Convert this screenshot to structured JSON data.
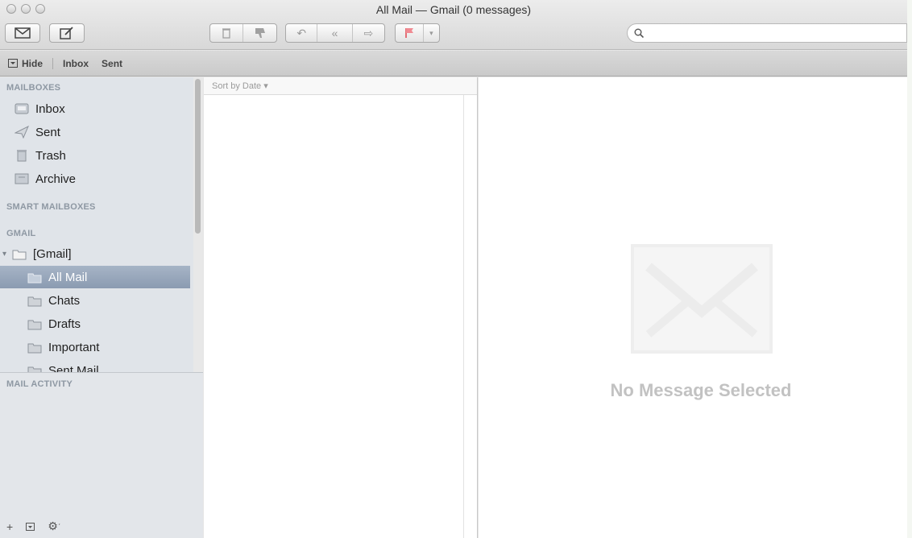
{
  "window": {
    "title": "All Mail — Gmail (0 messages)"
  },
  "toolbar": {
    "search_placeholder": ""
  },
  "favorites_bar": {
    "hide_label": "Hide",
    "items": [
      "Inbox",
      "Sent"
    ]
  },
  "sidebar": {
    "mailboxes_header": "MAILBOXES",
    "mailboxes": [
      {
        "label": "Inbox",
        "icon": "inbox-icon"
      },
      {
        "label": "Sent",
        "icon": "sent-icon"
      },
      {
        "label": "Trash",
        "icon": "trash-icon"
      },
      {
        "label": "Archive",
        "icon": "archive-icon"
      }
    ],
    "smart_header": "SMART MAILBOXES",
    "gmail_header": "GMAIL",
    "gmail_root": "[Gmail]",
    "gmail_folders": [
      {
        "label": "All Mail",
        "selected": true
      },
      {
        "label": "Chats",
        "selected": false
      },
      {
        "label": "Drafts",
        "selected": false
      },
      {
        "label": "Important",
        "selected": false
      },
      {
        "label": "Sent Mail",
        "selected": false
      }
    ],
    "activity_header": "MAIL ACTIVITY"
  },
  "message_list": {
    "sort_label": "Sort by Date ▾"
  },
  "reading_pane": {
    "empty_text": "No Message Selected"
  },
  "colors": {
    "selection": "#97a6bb",
    "sidebar_bg": "#e0e4e9",
    "flag_red": "#e0454f"
  }
}
